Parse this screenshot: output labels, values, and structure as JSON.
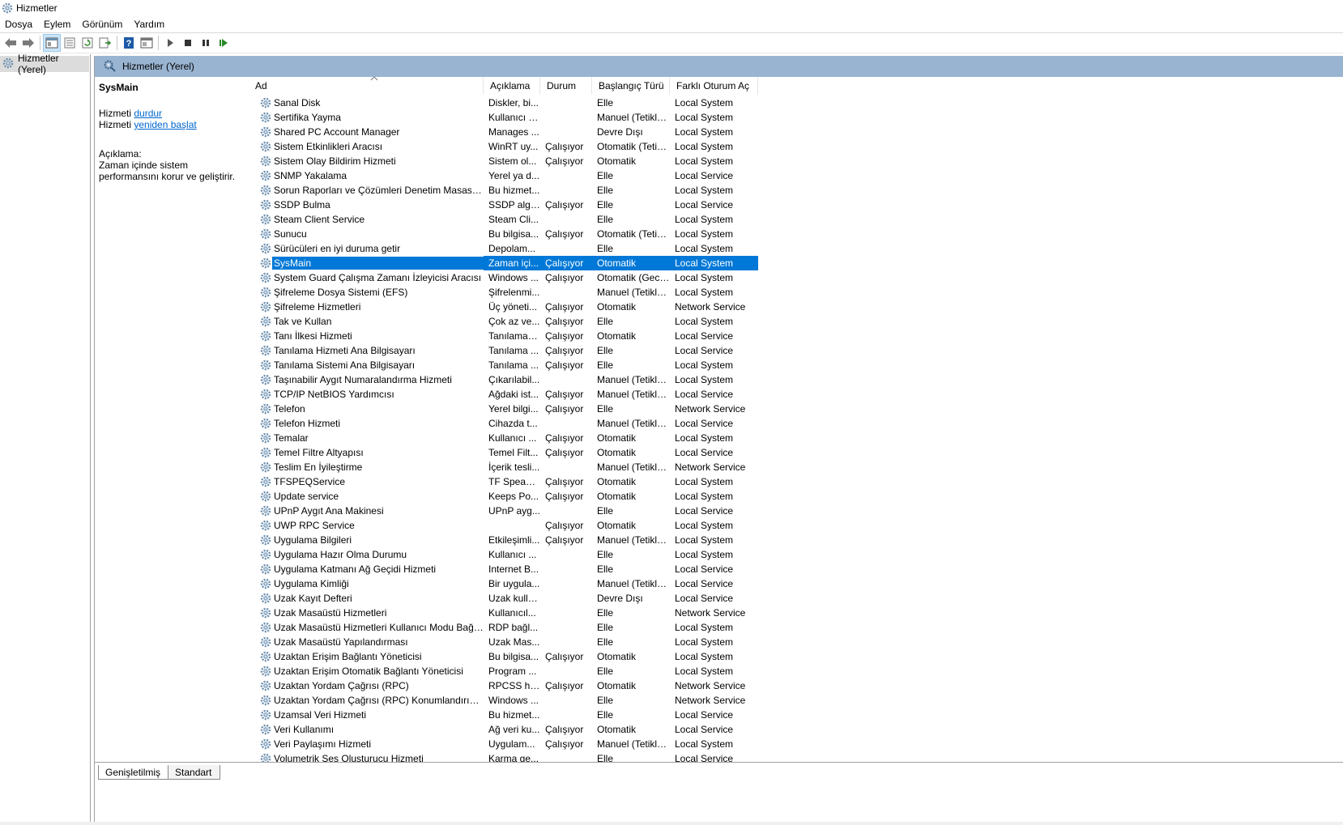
{
  "window": {
    "title": "Hizmetler"
  },
  "menu": [
    "Dosya",
    "Eylem",
    "Görünüm",
    "Yardım"
  ],
  "toolbar": {
    "icons": [
      "back-icon",
      "forward-icon",
      "show-hide-tree-icon",
      "properties-icon",
      "refresh-icon",
      "export-list-icon",
      "help-icon",
      "console-view-icon",
      "start-service-icon",
      "stop-service-icon",
      "pause-service-icon",
      "restart-service-icon"
    ]
  },
  "tree": {
    "root_label": "Hizmetler (Yerel)"
  },
  "header": {
    "label": "Hizmetler (Yerel)",
    "band_color": "#99b4d1"
  },
  "detail": {
    "service_name": "SysMain",
    "action1_prefix": "Hizmeti ",
    "action1_link": "durdur",
    "action2_prefix": "Hizmeti ",
    "action2_link": "yeniden başlat",
    "desc_label": "Açıklama:",
    "desc_text": "Zaman içinde sistem performansını korur ve geliştirir."
  },
  "columns": [
    "Ad",
    "Açıklama",
    "Durum",
    "Başlangıç Türü",
    "Farklı Oturum Aç"
  ],
  "selection_color": "#0078d7",
  "services": [
    {
      "name": "Sanal Disk",
      "desc": "Diskler, bi...",
      "status": "",
      "start": "Elle",
      "logon": "Local System"
    },
    {
      "name": "Sertifika Yayma",
      "desc": "Kullanıcı s...",
      "status": "",
      "start": "Manuel (Tetikle...",
      "logon": "Local System"
    },
    {
      "name": "Shared PC Account Manager",
      "desc": "Manages ...",
      "status": "",
      "start": "Devre Dışı",
      "logon": "Local System"
    },
    {
      "name": "Sistem Etkinlikleri Aracısı",
      "desc": "WinRT uy...",
      "status": "Çalışıyor",
      "start": "Otomatik (Tetik...",
      "logon": "Local System"
    },
    {
      "name": "Sistem Olay Bildirim Hizmeti",
      "desc": "Sistem ol...",
      "status": "Çalışıyor",
      "start": "Otomatik",
      "logon": "Local System"
    },
    {
      "name": "SNMP Yakalama",
      "desc": "Yerel ya d...",
      "status": "",
      "start": "Elle",
      "logon": "Local Service"
    },
    {
      "name": "Sorun Raporları ve Çözümleri Denetim Masası Deste...",
      "desc": "Bu hizmet...",
      "status": "",
      "start": "Elle",
      "logon": "Local System"
    },
    {
      "name": "SSDP Bulma",
      "desc": "SSDP algıl...",
      "status": "Çalışıyor",
      "start": "Elle",
      "logon": "Local Service"
    },
    {
      "name": "Steam Client Service",
      "desc": "Steam Cli...",
      "status": "",
      "start": "Elle",
      "logon": "Local System"
    },
    {
      "name": "Sunucu",
      "desc": "Bu bilgisa...",
      "status": "Çalışıyor",
      "start": "Otomatik (Tetik...",
      "logon": "Local System"
    },
    {
      "name": "Sürücüleri en iyi duruma getir",
      "desc": "Depolam...",
      "status": "",
      "start": "Elle",
      "logon": "Local System"
    },
    {
      "name": "SysMain",
      "desc": "Zaman içi...",
      "status": "Çalışıyor",
      "start": "Otomatik",
      "logon": "Local System",
      "selected": true
    },
    {
      "name": "System Guard Çalışma Zamanı İzleyicisi Aracısı",
      "desc": "Windows ...",
      "status": "Çalışıyor",
      "start": "Otomatik (Geci...",
      "logon": "Local System"
    },
    {
      "name": "Şifreleme Dosya Sistemi (EFS)",
      "desc": "Şifrelenmi...",
      "status": "",
      "start": "Manuel (Tetikle...",
      "logon": "Local System"
    },
    {
      "name": "Şifreleme Hizmetleri",
      "desc": "Üç yöneti...",
      "status": "Çalışıyor",
      "start": "Otomatik",
      "logon": "Network Service"
    },
    {
      "name": "Tak ve Kullan",
      "desc": "Çok az ve...",
      "status": "Çalışıyor",
      "start": "Elle",
      "logon": "Local System"
    },
    {
      "name": "Tanı İlkesi Hizmeti",
      "desc": "Tanılama İ...",
      "status": "Çalışıyor",
      "start": "Otomatik",
      "logon": "Local Service"
    },
    {
      "name": "Tanılama Hizmeti Ana Bilgisayarı",
      "desc": "Tanılama ...",
      "status": "Çalışıyor",
      "start": "Elle",
      "logon": "Local Service"
    },
    {
      "name": "Tanılama Sistemi Ana Bilgisayarı",
      "desc": "Tanılama ...",
      "status": "Çalışıyor",
      "start": "Elle",
      "logon": "Local System"
    },
    {
      "name": "Taşınabilir Aygıt Numaralandırma Hizmeti",
      "desc": "Çıkarılabil...",
      "status": "",
      "start": "Manuel (Tetikle...",
      "logon": "Local System"
    },
    {
      "name": "TCP/IP NetBIOS Yardımcısı",
      "desc": "Ağdaki ist...",
      "status": "Çalışıyor",
      "start": "Manuel (Tetikle...",
      "logon": "Local Service"
    },
    {
      "name": "Telefon",
      "desc": "Yerel bilgi...",
      "status": "Çalışıyor",
      "start": "Elle",
      "logon": "Network Service"
    },
    {
      "name": "Telefon Hizmeti",
      "desc": "Cihazda t...",
      "status": "",
      "start": "Manuel (Tetikle...",
      "logon": "Local Service"
    },
    {
      "name": "Temalar",
      "desc": "Kullanıcı ...",
      "status": "Çalışıyor",
      "start": "Otomatik",
      "logon": "Local System"
    },
    {
      "name": "Temel Filtre Altyapısı",
      "desc": "Temel Filt...",
      "status": "Çalışıyor",
      "start": "Otomatik",
      "logon": "Local Service"
    },
    {
      "name": "Teslim En İyileştirme",
      "desc": "İçerik tesli...",
      "status": "",
      "start": "Manuel (Tetikle...",
      "logon": "Network Service"
    },
    {
      "name": "TFSPEQService",
      "desc": "TF Speake...",
      "status": "Çalışıyor",
      "start": "Otomatik",
      "logon": "Local System"
    },
    {
      "name": "Update service",
      "desc": "Keeps Po...",
      "status": "Çalışıyor",
      "start": "Otomatik",
      "logon": "Local System"
    },
    {
      "name": "UPnP Aygıt Ana Makinesi",
      "desc": "UPnP ayg...",
      "status": "",
      "start": "Elle",
      "logon": "Local Service"
    },
    {
      "name": "UWP RPC Service",
      "desc": "",
      "status": "Çalışıyor",
      "start": "Otomatik",
      "logon": "Local System"
    },
    {
      "name": "Uygulama Bilgileri",
      "desc": "Etkileşimli...",
      "status": "Çalışıyor",
      "start": "Manuel (Tetikle...",
      "logon": "Local System"
    },
    {
      "name": "Uygulama Hazır Olma Durumu",
      "desc": "Kullanıcı ...",
      "status": "",
      "start": "Elle",
      "logon": "Local System"
    },
    {
      "name": "Uygulama Katmanı Ağ Geçidi Hizmeti",
      "desc": "Internet B...",
      "status": "",
      "start": "Elle",
      "logon": "Local Service"
    },
    {
      "name": "Uygulama Kimliği",
      "desc": "Bir uygula...",
      "status": "",
      "start": "Manuel (Tetikle...",
      "logon": "Local Service"
    },
    {
      "name": "Uzak Kayıt Defteri",
      "desc": "Uzak kulla...",
      "status": "",
      "start": "Devre Dışı",
      "logon": "Local Service"
    },
    {
      "name": "Uzak Masaüstü Hizmetleri",
      "desc": "Kullanıcıl...",
      "status": "",
      "start": "Elle",
      "logon": "Network Service"
    },
    {
      "name": "Uzak Masaüstü Hizmetleri Kullanıcı Modu Bağlantı ...",
      "desc": "RDP bağl...",
      "status": "",
      "start": "Elle",
      "logon": "Local System"
    },
    {
      "name": "Uzak Masaüstü Yapılandırması",
      "desc": "Uzak Mas...",
      "status": "",
      "start": "Elle",
      "logon": "Local System"
    },
    {
      "name": "Uzaktan Erişim Bağlantı Yöneticisi",
      "desc": "Bu bilgisa...",
      "status": "Çalışıyor",
      "start": "Otomatik",
      "logon": "Local System"
    },
    {
      "name": "Uzaktan Erişim Otomatik Bağlantı Yöneticisi",
      "desc": "Program ...",
      "status": "",
      "start": "Elle",
      "logon": "Local System"
    },
    {
      "name": "Uzaktan Yordam Çağrısı (RPC)",
      "desc": "RPCSS hiz...",
      "status": "Çalışıyor",
      "start": "Otomatik",
      "logon": "Network Service"
    },
    {
      "name": "Uzaktan Yordam Çağrısı (RPC) Konumlandırıcısı",
      "desc": "Windows ...",
      "status": "",
      "start": "Elle",
      "logon": "Network Service"
    },
    {
      "name": "Uzamsal Veri Hizmeti",
      "desc": "Bu hizmet...",
      "status": "",
      "start": "Elle",
      "logon": "Local Service"
    },
    {
      "name": "Veri Kullanımı",
      "desc": "Ağ veri ku...",
      "status": "Çalışıyor",
      "start": "Otomatik",
      "logon": "Local Service"
    },
    {
      "name": "Veri Paylaşımı Hizmeti",
      "desc": "Uygulam...",
      "status": "Çalışıyor",
      "start": "Manuel (Tetikle...",
      "logon": "Local System"
    },
    {
      "name": "Volumetrik Ses Oluşturucu Hizmeti",
      "desc": "Karma ge...",
      "status": "",
      "start": "Elle",
      "logon": "Local Service"
    }
  ],
  "tabs": [
    "Genişletilmiş",
    "Standart"
  ]
}
